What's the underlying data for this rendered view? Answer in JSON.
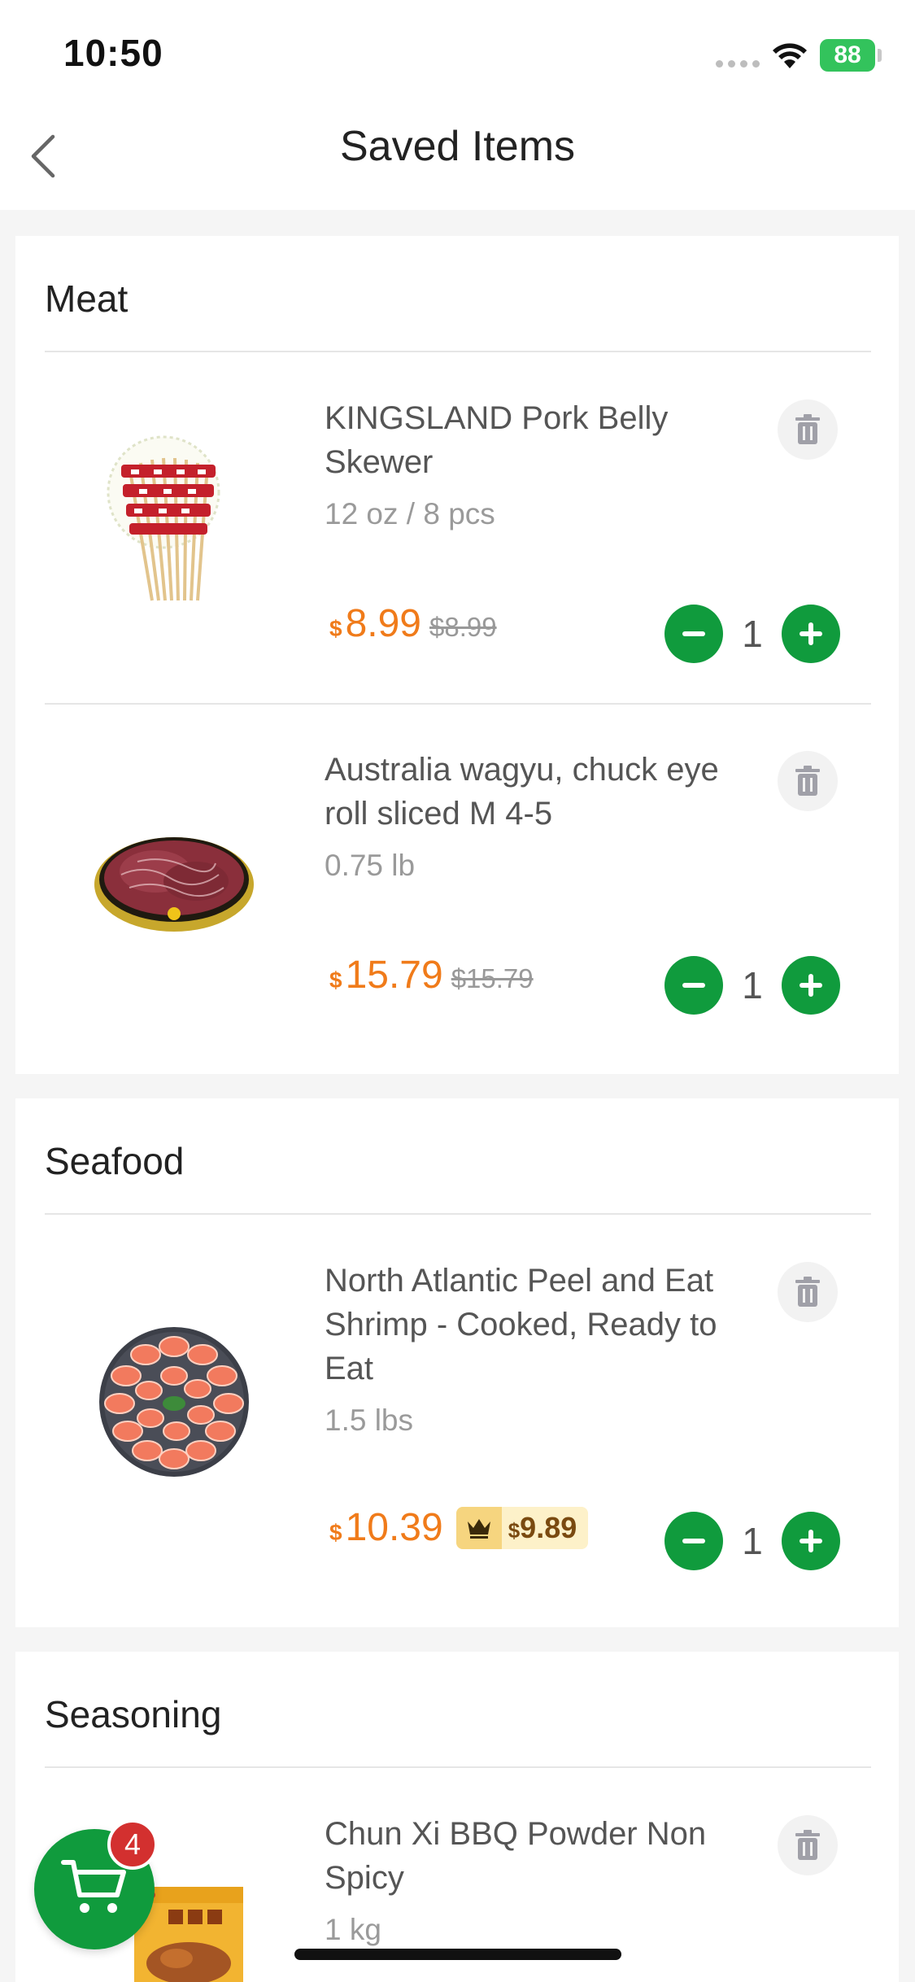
{
  "status_bar": {
    "time": "10:50",
    "battery": "88"
  },
  "nav": {
    "title": "Saved Items"
  },
  "sections": [
    {
      "title": "Meat",
      "items": [
        {
          "name": "KINGSLAND Pork Belly Skewer",
          "weight": "12 oz / 8 pcs",
          "currency": "$",
          "price": "8.99",
          "old_price": "$8.99",
          "quantity": "1"
        },
        {
          "name": "Australia wagyu, chuck eye roll sliced M 4-5",
          "weight": "0.75 lb",
          "currency": "$",
          "price": "15.79",
          "old_price": "$15.79",
          "quantity": "1"
        }
      ]
    },
    {
      "title": "Seafood",
      "items": [
        {
          "name": "North Atlantic Peel and Eat Shrimp - Cooked, Ready to Eat",
          "weight": "1.5 lbs",
          "currency": "$",
          "price": "10.39",
          "member_currency": "$",
          "member_price": "9.89",
          "quantity": "1"
        }
      ]
    },
    {
      "title": "Seasoning",
      "items": [
        {
          "name": "Chun Xi BBQ Powder Non Spicy",
          "weight": "1 kg"
        }
      ]
    }
  ],
  "cart": {
    "count": "4"
  },
  "colors": {
    "accent_green": "#109b3d",
    "price_orange": "#f07b1a",
    "badge_red": "#d3302f",
    "member_gold": "#f6d57f"
  },
  "icons": [
    "back-chevron-icon",
    "wifi-icon",
    "trash-icon",
    "minus-icon",
    "plus-icon",
    "crown-icon",
    "cart-icon"
  ]
}
